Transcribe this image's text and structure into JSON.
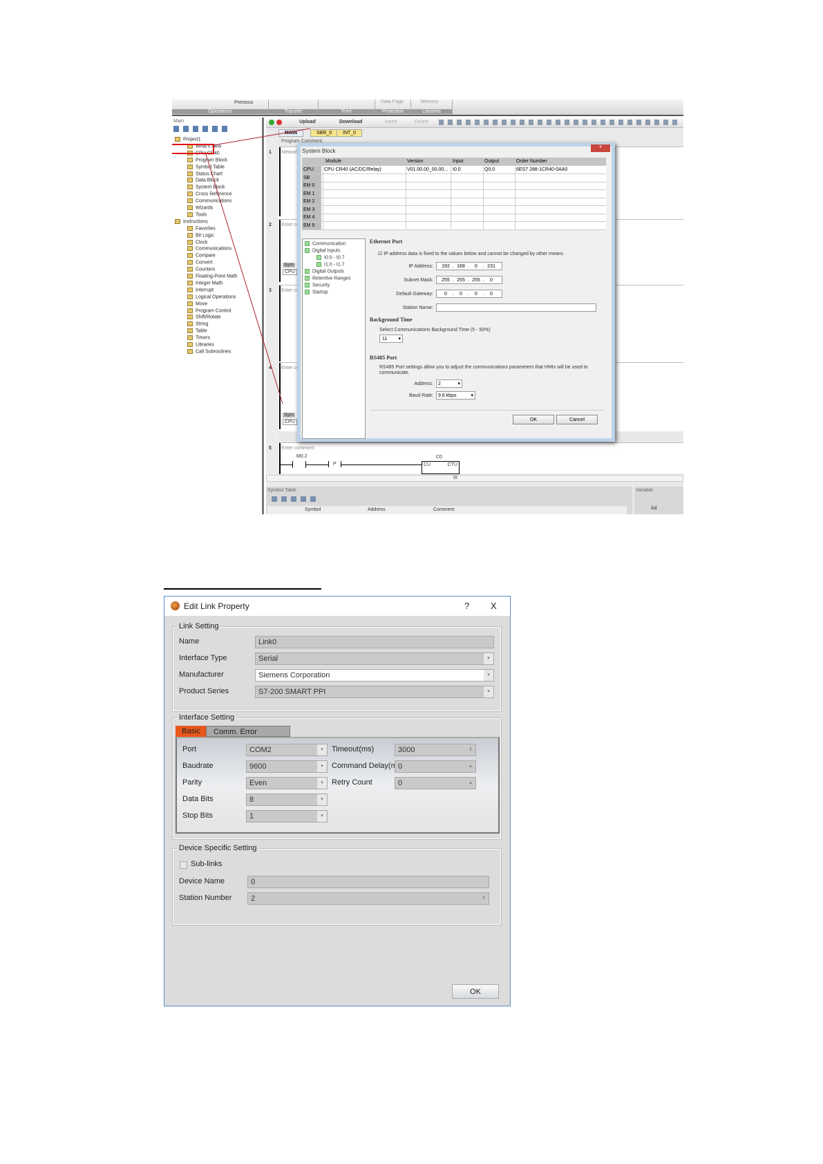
{
  "ribbon": {
    "groups": [
      "Operations",
      "Transfer",
      "Print",
      "Protection",
      "Libraries"
    ],
    "previous": "Previous",
    "data_page": "Data Page",
    "memory": "Memory"
  },
  "left_panel": {
    "title": "Main",
    "tree": [
      "Project1",
      "What's New",
      "CPU CR40",
      "Program Block",
      "Symbol Table",
      "Status Chart",
      "Data Block",
      "System Block",
      "Cross Reference",
      "Communications",
      "Wizards",
      "Tools",
      "Instructions",
      "Favorites",
      "Bit Logic",
      "Clock",
      "Communications",
      "Compare",
      "Convert",
      "Counters",
      "Floating-Point Math",
      "Integer Math",
      "Interrupt",
      "Logical Operations",
      "Move",
      "Program Control",
      "Shift/Rotate",
      "String",
      "Table",
      "Timers",
      "Libraries",
      "Call Subroutines"
    ]
  },
  "toolbar": {
    "upload": "Upload",
    "download": "Download",
    "insert": "Insert",
    "delete": "Delete"
  },
  "tabs": [
    "MAIN",
    "SBR_0",
    "INT_0"
  ],
  "editor": {
    "networks": [
      "1",
      "2",
      "3",
      "4",
      "5"
    ],
    "prog_comment": "Program Comment",
    "net1": "Network",
    "enter_comment": "Enter comment",
    "contact": "M0.2",
    "p": "P",
    "counter": "C0",
    "cu": "CU",
    "ctu": "CTU",
    "sym": "Sym",
    "cpu": "CPU"
  },
  "system_block": {
    "title": "System Block",
    "close": "x",
    "columns": [
      "Module",
      "Version",
      "Input",
      "Output",
      "Order Number"
    ],
    "rows": [
      {
        "h": "CPU",
        "module": "CPU CR40 (AC/DC/Relay)",
        "version": "V01.00.00_00.00...",
        "input": "I0.0",
        "output": "Q0.0",
        "order": "6ES7 288-1CR40-0AA0"
      },
      {
        "h": "SB"
      },
      {
        "h": "EM 0"
      },
      {
        "h": "EM 1"
      },
      {
        "h": "EM 2"
      },
      {
        "h": "EM 3"
      },
      {
        "h": "EM 4"
      },
      {
        "h": "EM 5"
      }
    ],
    "nav": [
      "Communication",
      "Digital Inputs",
      "I0.0 - I0.7",
      "I1.0 - I1.7",
      "Digital Outputs",
      "Retentive Ranges",
      "Security",
      "Startup"
    ],
    "ethernet_title": "Ethernet Port",
    "ip_fixed": "IP address data is fixed to the values below and cannot be changed by other means",
    "ip_label": "IP Address:",
    "ip": [
      "192",
      "168",
      "0",
      "231"
    ],
    "mask_label": "Subnet Mask:",
    "mask": [
      "255",
      "255",
      "255",
      "0"
    ],
    "gw_label": "Default Gateway:",
    "gw": [
      "0",
      "0",
      "0",
      "0"
    ],
    "station_label": "Station Name:",
    "station": "",
    "bg_title": "Background Time",
    "bg_desc": "Select Communications Background Time (5 - 50%)",
    "bg_value": "11",
    "rs_title": "RS485 Port",
    "rs_desc": "RS485 Port settings allow you to adjust the communications parameters that HMIs will be used to communicate.",
    "addr_label": "Address:",
    "addr": "2",
    "baud_label": "Baud Rate:",
    "baud": "9.6 kbps",
    "ok": "OK",
    "cancel": "Cancel"
  },
  "symbol_table": {
    "title": "Symbol Table",
    "cols": [
      "Symbol",
      "Address",
      "Comment"
    ],
    "variable": "Variable",
    "ad": "Ad",
    "scroll": "III"
  },
  "edit_link": {
    "title": "Edit Link Property",
    "help": "?",
    "close": "X",
    "link_setting": "Link Setting",
    "name_label": "Name",
    "name": "Link0",
    "itype_label": "Interface Type",
    "itype": "Serial",
    "mfr_label": "Manufacturer",
    "mfr": "Siemens Corporation",
    "series_label": "Product Series",
    "series": "S7-200 SMART PPI",
    "interface_setting": "Interface Setting",
    "tab_basic": "Basic",
    "tab_err": "Comm. Error Handling",
    "port_label": "Port",
    "port": "COM2",
    "baud_label": "Baudrate",
    "baud": "9600",
    "parity_label": "Parity",
    "parity": "Even",
    "databits_label": "Data Bits",
    "databits": "8",
    "stopbits_label": "Stop Bits",
    "stopbits": "1",
    "timeout_label": "Timeout(ms)",
    "timeout": "3000",
    "cmddelay_label": "Command Delay(ms)",
    "cmddelay": "0",
    "retry_label": "Retry Count",
    "retry": "0",
    "device_setting": "Device Specific Setting",
    "sublinks": "Sub-links",
    "devname_label": "Device Name",
    "devname": "0",
    "station_label": "Station Number",
    "station": "2",
    "ok": "OK",
    "accent": "#e8581a"
  }
}
